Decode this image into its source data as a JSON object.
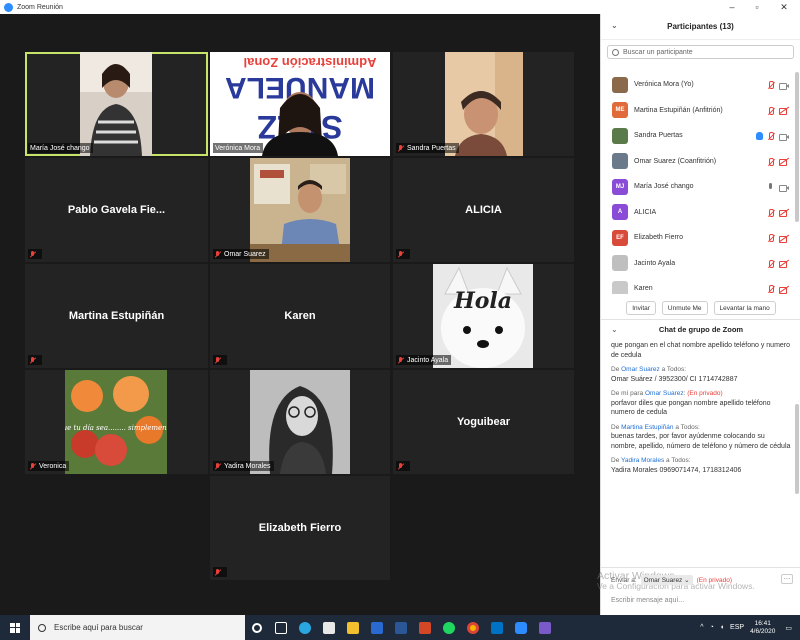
{
  "window": {
    "title": "Zoom Reunión"
  },
  "tiles": [
    {
      "label": "María José chango",
      "center_name": "",
      "active": true
    },
    {
      "label": "Verónica Mora",
      "center_name": "",
      "active": false
    },
    {
      "label": "Sandra Puertas",
      "center_name": "",
      "active": false
    },
    {
      "label": "",
      "center_name": "Pablo Gavela Fie...",
      "active": false
    },
    {
      "label": "Omar Suarez",
      "center_name": "",
      "active": false
    },
    {
      "label": "",
      "center_name": "ALICIA",
      "active": false
    },
    {
      "label": "",
      "center_name": "Martina Estupiñán",
      "active": false
    },
    {
      "label": "",
      "center_name": "Karen",
      "active": false
    },
    {
      "label": "Jacinto Ayala",
      "center_name": "",
      "active": false
    },
    {
      "label": "Veronica",
      "center_name": "",
      "active": false
    },
    {
      "label": "Yadira Morales",
      "center_name": "",
      "active": false
    },
    {
      "label": "",
      "center_name": "Yoguibear",
      "active": false
    },
    {
      "label": "",
      "center_name": "Elizabeth Fierro",
      "active": false
    }
  ],
  "images": {
    "banner_line1": "Administración Zonal",
    "banner_line2": "MANUELA",
    "banner_line3": "SÁEZ",
    "hola": "Hola",
    "flower_msg": "Que tu día sea........ simplemente bello"
  },
  "participants": {
    "header": "Participantes (13)",
    "search_placeholder": "Buscar un participante",
    "list": [
      {
        "name": "Verónica Mora (Yo)",
        "initials": "",
        "avatar_color": "#8a6a4a"
      },
      {
        "name": "Martina Estupiñán (Anfitrión)",
        "initials": "ME",
        "avatar_color": "#e06a3a"
      },
      {
        "name": "Sandra Puertas",
        "initials": "",
        "avatar_color": "#5a7a4a"
      },
      {
        "name": "Omar Suarez (Coanfitrión)",
        "initials": "",
        "avatar_color": "#6a7a8a"
      },
      {
        "name": "María José chango",
        "initials": "MJ",
        "avatar_color": "#8a4bd6"
      },
      {
        "name": "ALICIA",
        "initials": "A",
        "avatar_color": "#8a4bd6"
      },
      {
        "name": "Elizabeth Fierro",
        "initials": "EF",
        "avatar_color": "#d84a3a"
      },
      {
        "name": "Jacinto Ayala",
        "initials": "",
        "avatar_color": "#bfbfbf"
      },
      {
        "name": "Karen",
        "initials": "",
        "avatar_color": "#c9c9c9"
      }
    ],
    "invite_label": "Invitar",
    "unmute_label": "Unmute Me",
    "raise_hand_label": "Levantar la mano"
  },
  "chat": {
    "header": "Chat de grupo de Zoom",
    "messages": [
      {
        "from_prefix": "",
        "from_name": "",
        "to": "",
        "private": "",
        "text": "que pongan en el chat nombre apellido teléfono y numero de cedula"
      },
      {
        "from_prefix": "De ",
        "from_name": "Omar Suarez",
        "to": " a Todos:",
        "private": "",
        "text": "Omar Suárez  / 3952300/ CI 1714742887"
      },
      {
        "from_prefix": "De mí para ",
        "from_name": "Omar Suarez",
        "to": ":",
        "private": "(En privado)",
        "text": "porfavor diles que pongan nombre apellido teléfono numero de cedula"
      },
      {
        "from_prefix": "De ",
        "from_name": "Martina Estupiñán",
        "to": " a Todos:",
        "private": "",
        "text": "buenas tardes, por favor ayúdenme colocando su nombre, apellido, número de teléfono y número de cédula"
      },
      {
        "from_prefix": "De ",
        "from_name": "Yadira Morales",
        "to": " a Todos:",
        "private": "",
        "text": "Yadira Morales 0969071474, 1718312406"
      }
    ],
    "send_to_label": "Enviar a:",
    "send_to_target": "Omar Suarez",
    "send_private": "(En privado)",
    "input_placeholder": "Escribir mensaje aquí...",
    "watermark_line1": "Activar Windows",
    "watermark_line2": "Ve a Configuración para activar Windows."
  },
  "taskbar": {
    "search_placeholder": "Escribe aquí para buscar",
    "lang": "ESP",
    "time": "16:41",
    "date": "4/6/2020"
  }
}
